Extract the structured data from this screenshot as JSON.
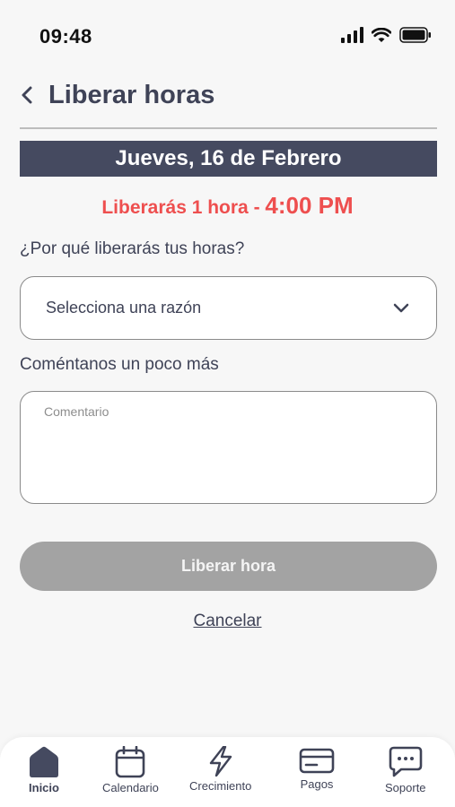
{
  "status_bar": {
    "time": "09:48"
  },
  "header": {
    "title": "Liberar horas"
  },
  "date_banner": {
    "text": "Jueves, 16 de Febrero"
  },
  "release": {
    "prefix": "Liberarás 1 hora - ",
    "time": "4:00 PM"
  },
  "form": {
    "question_label": "¿Por qué liberarás tus horas?",
    "reason_select": {
      "placeholder": "Selecciona una razón"
    },
    "comment_label": "Coméntanos un poco más",
    "comment_placeholder": "Comentario",
    "submit_label": "Liberar hora",
    "cancel_label": "Cancelar"
  },
  "bottom_nav": {
    "items": [
      {
        "label": "Inicio",
        "icon": "home-icon",
        "active": true
      },
      {
        "label": "Calendario",
        "icon": "calendar-icon",
        "active": false
      },
      {
        "label": "Crecimiento",
        "icon": "lightning-icon",
        "active": false
      },
      {
        "label": "Pagos",
        "icon": "card-icon",
        "active": false
      },
      {
        "label": "Soporte",
        "icon": "chat-icon",
        "active": false
      }
    ]
  },
  "colors": {
    "dark": "#454a60",
    "text": "#3f4357",
    "accent_red": "#ee4f4f",
    "disabled_button": "#a3a3a3"
  }
}
